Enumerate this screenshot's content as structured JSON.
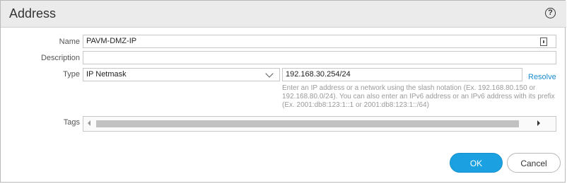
{
  "dialog": {
    "title": "Address",
    "help_icon": "?"
  },
  "form": {
    "name": {
      "label": "Name",
      "value": "PAVM-DMZ-IP"
    },
    "description": {
      "label": "Description",
      "value": ""
    },
    "type": {
      "label": "Type",
      "selected": "IP Netmask",
      "value": "192.168.30.254/24",
      "resolve_label": "Resolve",
      "help_lines": [
        "Enter an IP address or a network using the slash notation (Ex. 192.168.80.150 or",
        "192.168.80.0/24). You can also enter an IPv6 address or an IPv6 address with its prefix",
        "(Ex. 2001:db8:123:1::1 or 2001:db8:123:1::/64)"
      ]
    },
    "tags": {
      "label": "Tags"
    }
  },
  "buttons": {
    "ok": "OK",
    "cancel": "Cancel"
  },
  "colors": {
    "accent": "#1ba1e2",
    "link": "#1b8fd1",
    "titlebar": "#ebebeb"
  }
}
